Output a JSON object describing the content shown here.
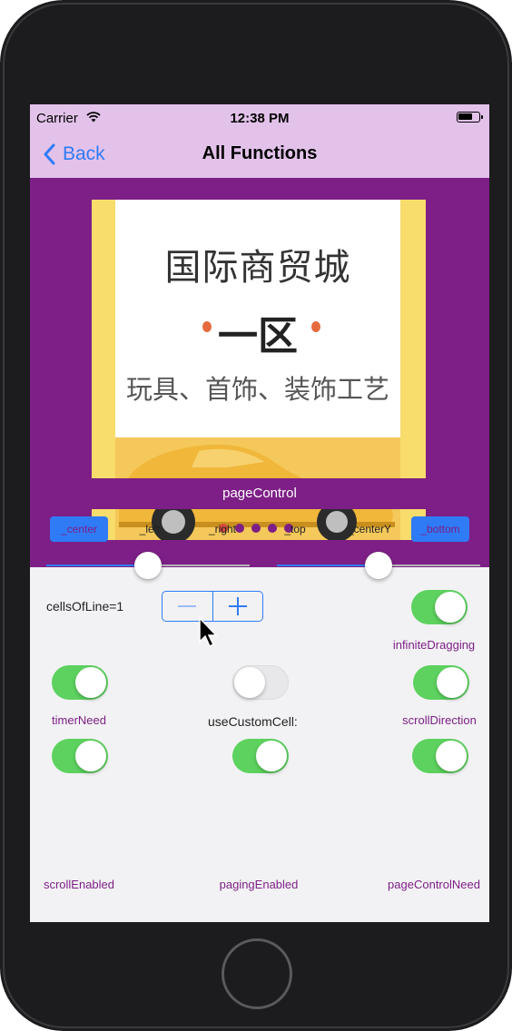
{
  "status_bar": {
    "carrier": "Carrier",
    "time": "12:38 PM"
  },
  "nav": {
    "back_label": "Back",
    "title": "All Functions"
  },
  "banner": {
    "line1": "国际商贸城",
    "line2": "一区",
    "line3": "玩具、首饰、装饰工艺",
    "page_count": 5,
    "current_page": 0
  },
  "controls": {
    "page_control_label": "pageControl",
    "positions": [
      "_center",
      "_left",
      "_right",
      "_top",
      "_centerY",
      "_bottom"
    ],
    "left_slider_value": 0.5,
    "right_slider_value": 0.5,
    "cells_of_line": "cellsOfLine=1",
    "stepper_minus": "−",
    "stepper_plus": "+",
    "use_custom_cell": "useCustomCell:",
    "toggles": {
      "infinite_dragging": "infiniteDragging",
      "timer_need": "timerNeed",
      "scroll_direction": "scrollDirection",
      "scroll_enabled": "scrollEnabled",
      "paging_enabled": "pagingEnabled",
      "page_control_need": "pageControlNeed"
    }
  },
  "colors": {
    "nav_bg": "#e3c2ea",
    "banner_bg": "#7d1f86",
    "accent_blue": "#2f7bf6",
    "toggle_on": "#5dd25f"
  }
}
